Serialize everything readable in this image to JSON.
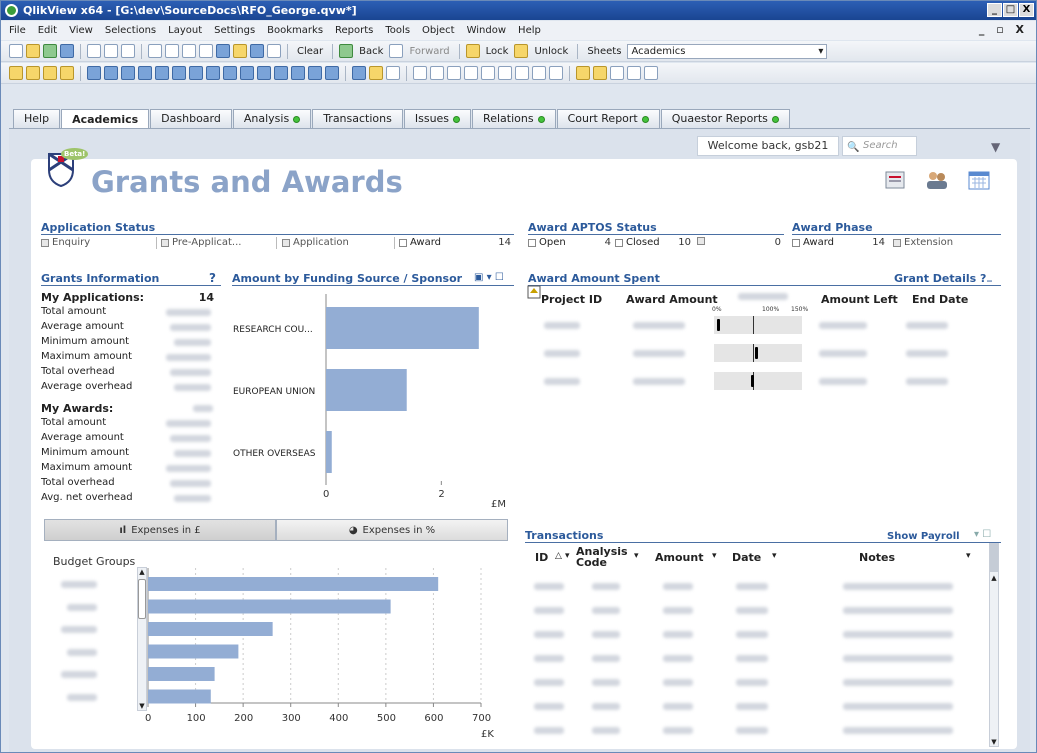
{
  "window": {
    "title": "QlikView x64 - [G:\\dev\\SourceDocs\\RFO_George.qvw*]",
    "controls": [
      "_",
      "□",
      "X"
    ]
  },
  "menu": [
    "File",
    "Edit",
    "View",
    "Selections",
    "Layout",
    "Settings",
    "Bookmarks",
    "Reports",
    "Tools",
    "Object",
    "Window",
    "Help"
  ],
  "mdi_controls": "_ ▫ X",
  "toolbar": {
    "clear": "Clear",
    "back": "Back",
    "forward": "Forward",
    "lock": "Lock",
    "unlock": "Unlock",
    "sheets_label": "Sheets",
    "sheets_value": "Academics"
  },
  "tabs": [
    {
      "label": "Help",
      "dot": false
    },
    {
      "label": "Academics",
      "dot": false,
      "active": true
    },
    {
      "label": "Dashboard",
      "dot": false
    },
    {
      "label": "Analysis",
      "dot": true
    },
    {
      "label": "Transactions",
      "dot": false
    },
    {
      "label": "Issues",
      "dot": true
    },
    {
      "label": "Relations",
      "dot": true
    },
    {
      "label": "Court Report",
      "dot": true
    },
    {
      "label": "Quaestor Reports",
      "dot": true
    }
  ],
  "header": {
    "welcome": "Welcome back, gsb21",
    "search_placeholder": "Search",
    "beta": "Beta!",
    "title": "Grants and Awards"
  },
  "application_status": {
    "title": "Application Status",
    "items": [
      "Enquiry",
      "Pre-Applicat...",
      "Application",
      "Award"
    ],
    "award_count": "14"
  },
  "aptos_status": {
    "title": "Award APTOS Status",
    "open_label": "Open",
    "open_count": "4",
    "closed_label": "Closed",
    "closed_count": "10",
    "other_count": "0"
  },
  "award_phase": {
    "title": "Award Phase",
    "award_label": "Award",
    "award_count": "14",
    "extension_label": "Extension"
  },
  "grants_info": {
    "title": "Grants Information",
    "help": "?",
    "my_applications_label": "My Applications:",
    "my_applications_count": "14",
    "app_rows": [
      "Total amount",
      "Average amount",
      "Minimum amount",
      "Maximum amount",
      "Total overhead",
      "Average overhead"
    ],
    "my_awards_label": "My Awards:",
    "award_rows": [
      "Total amount",
      "Average amount",
      "Minimum amount",
      "Maximum amount",
      "Total overhead",
      "Avg. net overhead"
    ]
  },
  "funding_chart": {
    "title": "Amount by Funding Source / Sponsor",
    "unit": "£M",
    "chart_data": {
      "type": "bar",
      "orientation": "horizontal",
      "categories": [
        "RESEARCH COU...",
        "EUROPEAN UNION",
        "OTHER OVERSEAS"
      ],
      "values": [
        2.65,
        1.4,
        0.1
      ],
      "xlim": [
        0,
        3
      ],
      "ticks": [
        "0",
        "2"
      ]
    }
  },
  "award_spent": {
    "title": "Award Amount Spent",
    "grant_details": "Grant Details ?",
    "columns": [
      "Project ID",
      "Award Amount",
      "Amount Left",
      "End Date"
    ],
    "gauge_scale": [
      "0%",
      "100%",
      "150%"
    ],
    "rows": [
      {
        "needle_pct": 0.02,
        "ref_pct": 1.0
      },
      {
        "needle_pct": 1.0,
        "ref_pct": 1.0
      },
      {
        "needle_pct": 0.9,
        "ref_pct": 1.0
      }
    ]
  },
  "expenses_buttons": {
    "pounds": "Expenses in £",
    "percent": "Expenses in %"
  },
  "budget_chart": {
    "title": "Budget Groups",
    "unit": "£K",
    "chart_data": {
      "type": "bar",
      "orientation": "horizontal",
      "values": [
        610,
        510,
        262,
        190,
        140,
        132
      ],
      "xlim": [
        0,
        700
      ],
      "ticks": [
        "0",
        "100",
        "200",
        "300",
        "400",
        "500",
        "600",
        "700"
      ]
    }
  },
  "transactions": {
    "title": "Transactions",
    "show_payroll": "Show Payroll",
    "columns": [
      {
        "label": "ID",
        "sort": "△ ▾"
      },
      {
        "label": "Analysis Code",
        "sort": "▾"
      },
      {
        "label": "Amount",
        "sort": "▾"
      },
      {
        "label": "Date",
        "sort": "▾"
      },
      {
        "label": "Notes",
        "sort": "▾"
      }
    ],
    "row_count": 7
  }
}
